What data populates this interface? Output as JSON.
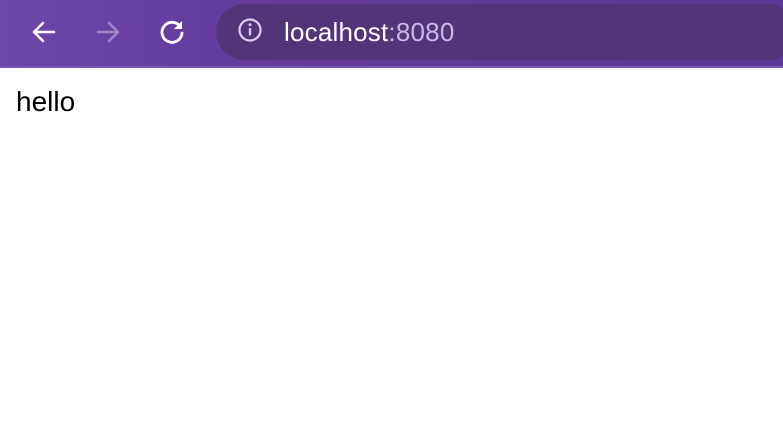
{
  "toolbar": {
    "back_icon": "arrow-left-icon",
    "forward_icon": "arrow-right-icon",
    "reload_icon": "reload-icon",
    "forward_enabled": false,
    "colors": {
      "background": "#6440a0",
      "omnibox": "#513578",
      "icon": "#ffffff",
      "icon_disabled": "#9c86c6",
      "port_text": "#c9b8e6"
    }
  },
  "address_bar": {
    "info_icon": "info-circle-icon",
    "host": "localhost",
    "port": ":8080"
  },
  "page": {
    "body_text": "hello"
  }
}
